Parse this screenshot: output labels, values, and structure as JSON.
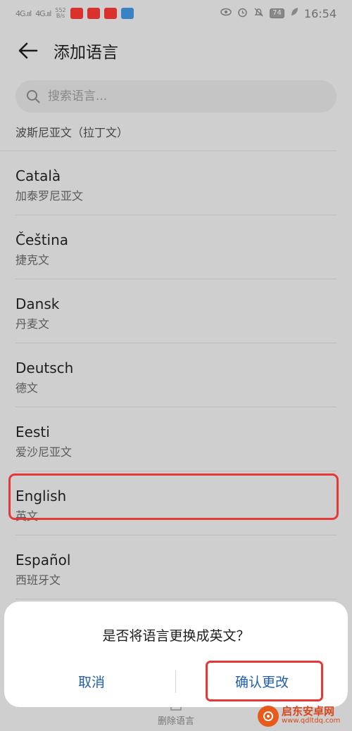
{
  "status_bar": {
    "signal_1": "4G.ııl",
    "signal_2": "4G.ııl",
    "speed_value": "552",
    "speed_unit": "B/s",
    "battery": "74",
    "time": "16:54"
  },
  "app_bar": {
    "title": "添加语言"
  },
  "search": {
    "placeholder": "搜索语言..."
  },
  "list": {
    "partial_first": "波斯尼亚文（拉丁文）",
    "items": [
      {
        "name": "Català",
        "sub": "加泰罗尼亚文"
      },
      {
        "name": "Čeština",
        "sub": "捷克文"
      },
      {
        "name": "Dansk",
        "sub": "丹麦文"
      },
      {
        "name": "Deutsch",
        "sub": "德文"
      },
      {
        "name": "Eesti",
        "sub": "爱沙尼亚文"
      },
      {
        "name": "English",
        "sub": "英文"
      },
      {
        "name": "Español",
        "sub": "西班牙文"
      }
    ]
  },
  "bottom_bar": {
    "delete_label": "删除语言"
  },
  "dialog": {
    "message": "是否将语言更换成英文？",
    "cancel": "取消",
    "confirm": "确认更改"
  },
  "watermark": {
    "name": "启东安卓网",
    "url": "www.qdltdq.com"
  },
  "colors": {
    "accent": "#1f5fae",
    "highlight": "#e53935"
  }
}
